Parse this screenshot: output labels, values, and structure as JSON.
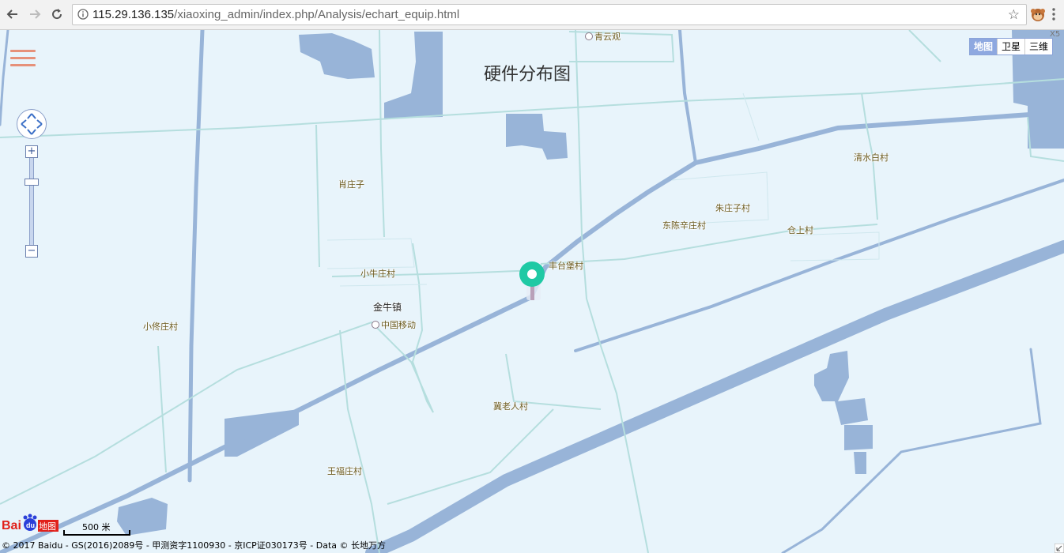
{
  "browser": {
    "back_icon": "arrow-left-icon",
    "forward_icon": "arrow-right-icon",
    "reload_icon": "reload-icon",
    "url_host": "115.29.136.135",
    "url_path": "/xiaoxing_admin/index.php/Analysis/echart_equip.html",
    "bookmark_icon": "star-icon",
    "extension_icon": "monkey-extension-icon"
  },
  "map": {
    "title": "硬件分布图",
    "map_types": [
      "地图",
      "卫星",
      "三维"
    ],
    "active_map_type": "地图",
    "road_number": "X5",
    "zoom_in_label": "+",
    "zoom_out_label": "−",
    "marker_label": "",
    "places": [
      {
        "name": "青云观",
        "poi": true
      },
      {
        "name": "肖庄子"
      },
      {
        "name": "清水白村"
      },
      {
        "name": "朱庄子村"
      },
      {
        "name": "东陈辛庄村"
      },
      {
        "name": "仓上村"
      },
      {
        "name": "丰台堡村"
      },
      {
        "name": "小牛庄村"
      },
      {
        "name": "金牛镇",
        "town": true
      },
      {
        "name": "中国移动",
        "poi": true
      },
      {
        "name": "小佟庄村"
      },
      {
        "name": "冀老人村"
      },
      {
        "name": "王福庄村"
      }
    ],
    "scale_label": "500 米",
    "baidu_logo_text": "Bai地图",
    "copyright": "© 2017 Baidu - GS(2016)2089号 - 甲测资字1100930 - 京ICP证030173号 - Data © 长地万方"
  },
  "colors": {
    "water": "#98b4d8",
    "land": "#e8f4fb",
    "minor_road": "#b5dede",
    "major_road": "#98b4d8",
    "marker": "#1fc9a4",
    "hamburger": "#e6917a"
  }
}
